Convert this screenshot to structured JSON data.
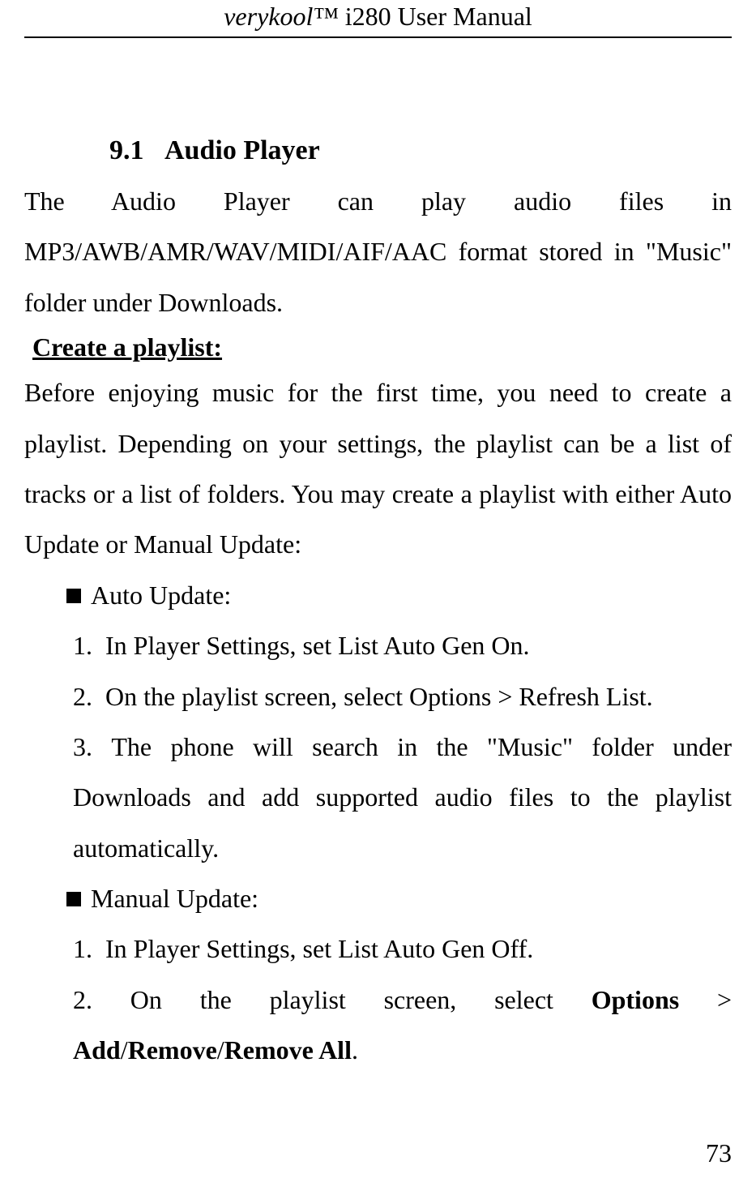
{
  "header": {
    "brand_italic": "verykool™",
    "title_rest": " i280 User Manual"
  },
  "section": {
    "number": "9.1",
    "title": "Audio Player"
  },
  "intro_para": "The Audio Player can play audio files in MP3/AWB/AMR/WAV/MIDI/AIF/AAC format stored in \"Music\" folder under Downloads.",
  "subheadings": {
    "create_playlist": "Create a playlist:"
  },
  "create_intro": "Before enjoying music for the first time, you need to create a playlist. Depending on your settings, the playlist can be a list of tracks or a list of folders. You may create a playlist with either Auto Update or Manual Update:",
  "auto_update": {
    "label": "Auto Update:",
    "items": [
      "In Player Settings, set List Auto Gen On.",
      "On the playlist screen, select Options > Refresh List.",
      "The phone will search in the \"Music\" folder under Downloads and add supported audio files to the playlist automatically."
    ]
  },
  "manual_update": {
    "label": "Manual Update:",
    "items": {
      "one": "In Player Settings, set List Auto Gen Off.",
      "two_prefix": "On the playlist screen, select ",
      "two_bold1": "Options",
      "two_mid": " > ",
      "two_bold2": "Add",
      "two_slash1": "/",
      "two_bold3": "Remove",
      "two_slash2": "/",
      "two_bold4": "Remove All",
      "two_suffix": "."
    }
  },
  "page_number": "73"
}
